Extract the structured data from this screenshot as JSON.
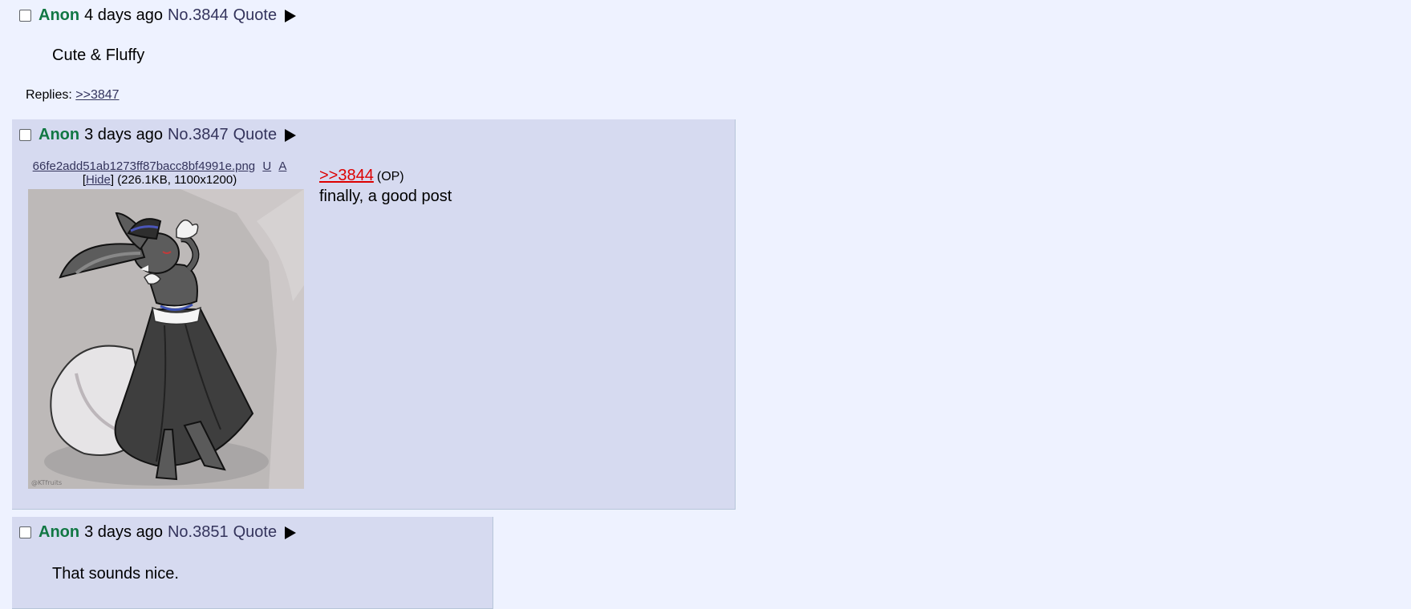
{
  "posts": [
    {
      "name": "Anon",
      "date": "4 days ago",
      "number": "No.3844",
      "quote_label": "Quote",
      "text": "Cute & Fluffy",
      "replies_label": "Replies:",
      "replies_link": ">>3847"
    },
    {
      "name": "Anon",
      "date": "3 days ago",
      "number": "No.3847",
      "quote_label": "Quote",
      "file": {
        "filename": "66fe2add51ab1273ff87bacc8bf4991e.png",
        "u_link": "U",
        "a_link": "A",
        "hide_open": "[",
        "hide_label": "Hide",
        "hide_close": "]",
        "meta": "(226.1KB, 1100x1200)"
      },
      "quote_ref": ">>3844",
      "op_tag": "(OP)",
      "text": "finally, a good post"
    },
    {
      "name": "Anon",
      "date": "3 days ago",
      "number": "No.3851",
      "quote_label": "Quote",
      "text": "That sounds nice."
    }
  ],
  "image": {
    "subject": "grey anthropomorphic fox-rabbit character in black dress with red-white-blue collar",
    "watermark": "@KTfruits"
  },
  "colors": {
    "background": "#eef2ff",
    "reply_background": "#d6daf0",
    "name": "#117743",
    "link": "#34345c",
    "quotelink": "#dd0000"
  }
}
